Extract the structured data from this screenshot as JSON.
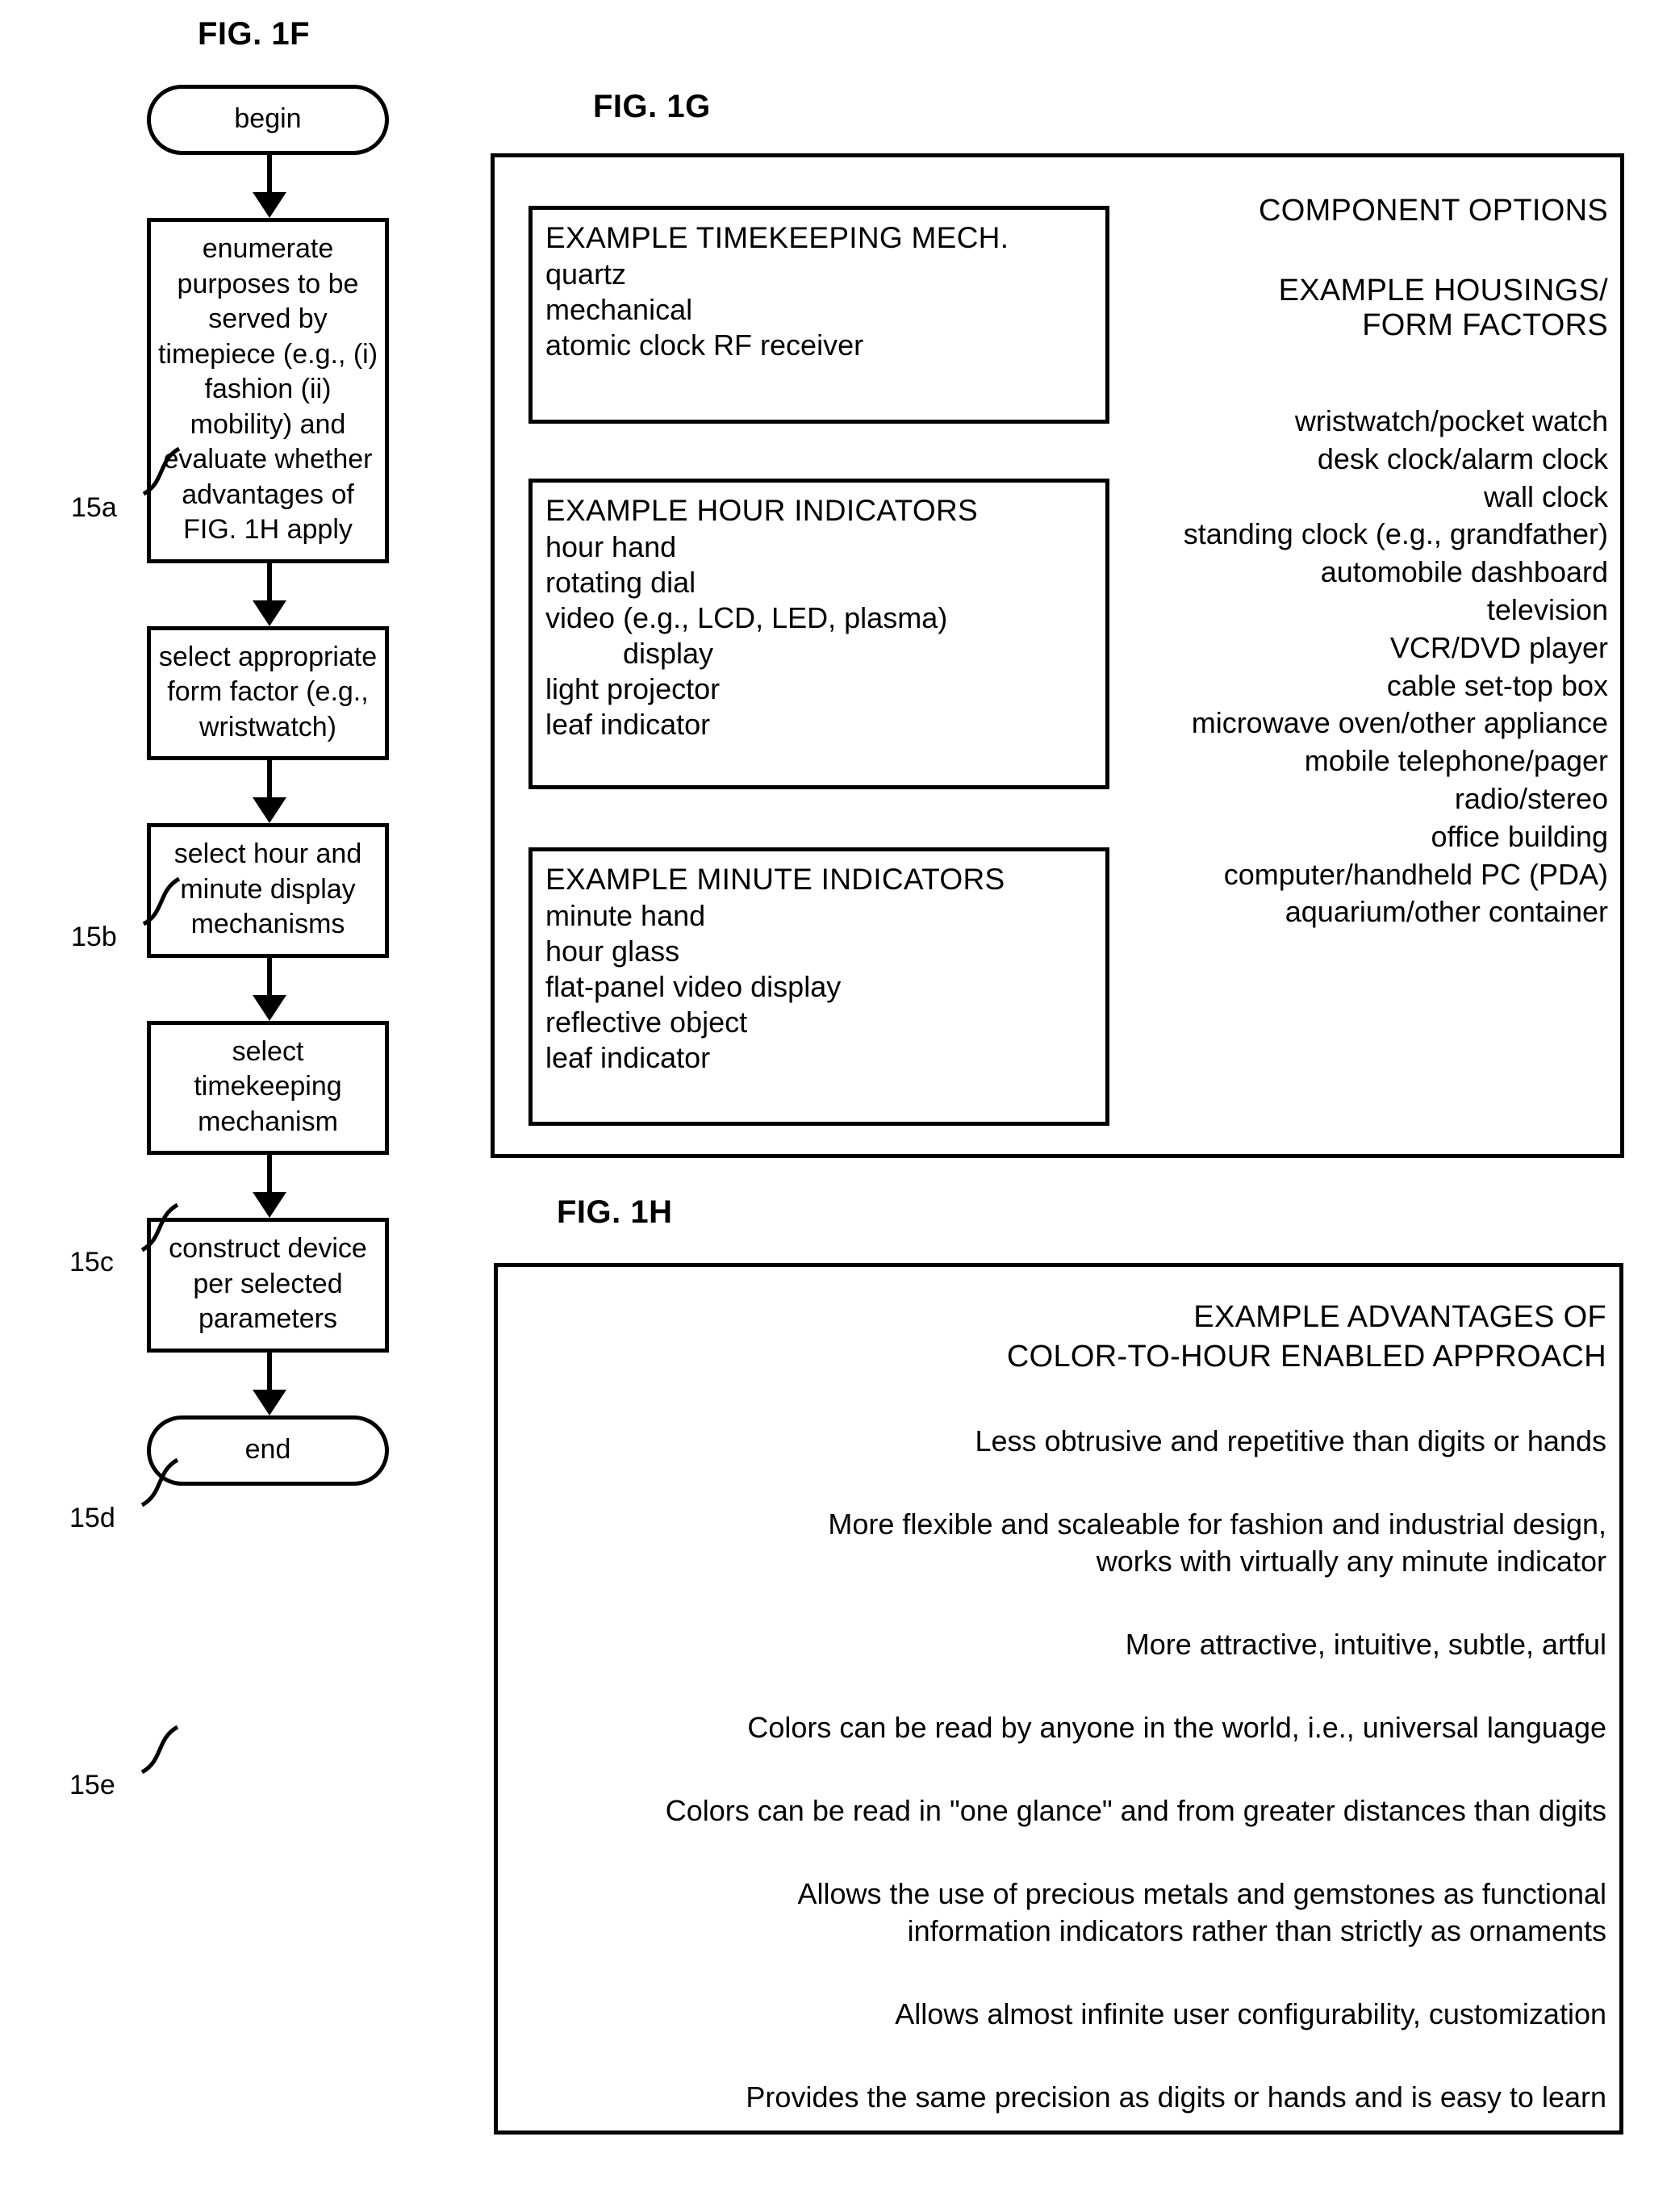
{
  "fig1f": {
    "title": "FIG. 1F",
    "nodes": [
      {
        "type": "terminal",
        "label": "begin"
      },
      {
        "type": "process",
        "ref": "15a",
        "label": "enumerate purposes to be served by timepiece (e.g., (i) fashion (ii) mobility) and evaluate whether advantages of FIG. 1H apply"
      },
      {
        "type": "process",
        "ref": "15b",
        "label": "select appropriate form factor (e.g., wristwatch)"
      },
      {
        "type": "process",
        "ref": "15c",
        "label": "select hour and minute display mechanisms"
      },
      {
        "type": "process",
        "ref": "15d",
        "label": "select timekeeping mechanism"
      },
      {
        "type": "process",
        "ref": "15e",
        "label": "construct device per selected parameters"
      },
      {
        "type": "terminal",
        "label": "end"
      }
    ],
    "refs": {
      "a": "15a",
      "b": "15b",
      "c": "15c",
      "d": "15d",
      "e": "15e"
    }
  },
  "fig1g": {
    "title": "FIG. 1G",
    "timekeeping": {
      "heading": "EXAMPLE TIMEKEEPING MECH.",
      "items": [
        "quartz",
        "mechanical",
        "atomic clock RF receiver"
      ]
    },
    "hour_indicators": {
      "heading": "EXAMPLE HOUR INDICATORS",
      "items": [
        "hour hand",
        "rotating dial",
        "video (e.g., LCD, LED, plasma)",
        "display",
        "light projector",
        "leaf indicator"
      ]
    },
    "minute_indicators": {
      "heading": "EXAMPLE MINUTE INDICATORS",
      "items": [
        "minute hand",
        "hour glass",
        "flat-panel video display",
        "reflective object",
        "leaf indicator"
      ]
    },
    "component_options": {
      "heading": "COMPONENT OPTIONS",
      "housings_heading_line1": "EXAMPLE HOUSINGS/",
      "housings_heading_line2": "FORM FACTORS",
      "housings": [
        "wristwatch/pocket watch",
        "desk clock/alarm clock",
        "wall clock",
        "standing clock (e.g., grandfather)",
        "automobile dashboard",
        "television",
        "VCR/DVD player",
        "cable set-top box",
        "microwave oven/other appliance",
        "mobile telephone/pager",
        "radio/stereo",
        "office building",
        "computer/handheld PC (PDA)",
        "aquarium/other container"
      ]
    }
  },
  "fig1h": {
    "title": "FIG. 1H",
    "heading_line1": "EXAMPLE ADVANTAGES OF",
    "heading_line2": "COLOR-TO-HOUR ENABLED APPROACH",
    "advantages": [
      {
        "line1": "Less obtrusive and repetitive than digits or hands",
        "line2": ""
      },
      {
        "line1": "More flexible and scaleable for fashion and industrial design,",
        "line2": "works with virtually any minute indicator"
      },
      {
        "line1": "More attractive, intuitive, subtle, artful",
        "line2": ""
      },
      {
        "line1": "Colors can be read by anyone in the world, i.e., universal language",
        "line2": ""
      },
      {
        "line1": "Colors can be read in \"one glance\" and from greater distances than digits",
        "line2": ""
      },
      {
        "line1": "Allows the use of precious metals and gemstones as functional",
        "line2": "information indicators rather than strictly as ornaments"
      },
      {
        "line1": "Allows almost infinite user configurability, customization",
        "line2": ""
      },
      {
        "line1": "Provides the same precision as digits or hands and is easy to learn",
        "line2": ""
      }
    ]
  }
}
